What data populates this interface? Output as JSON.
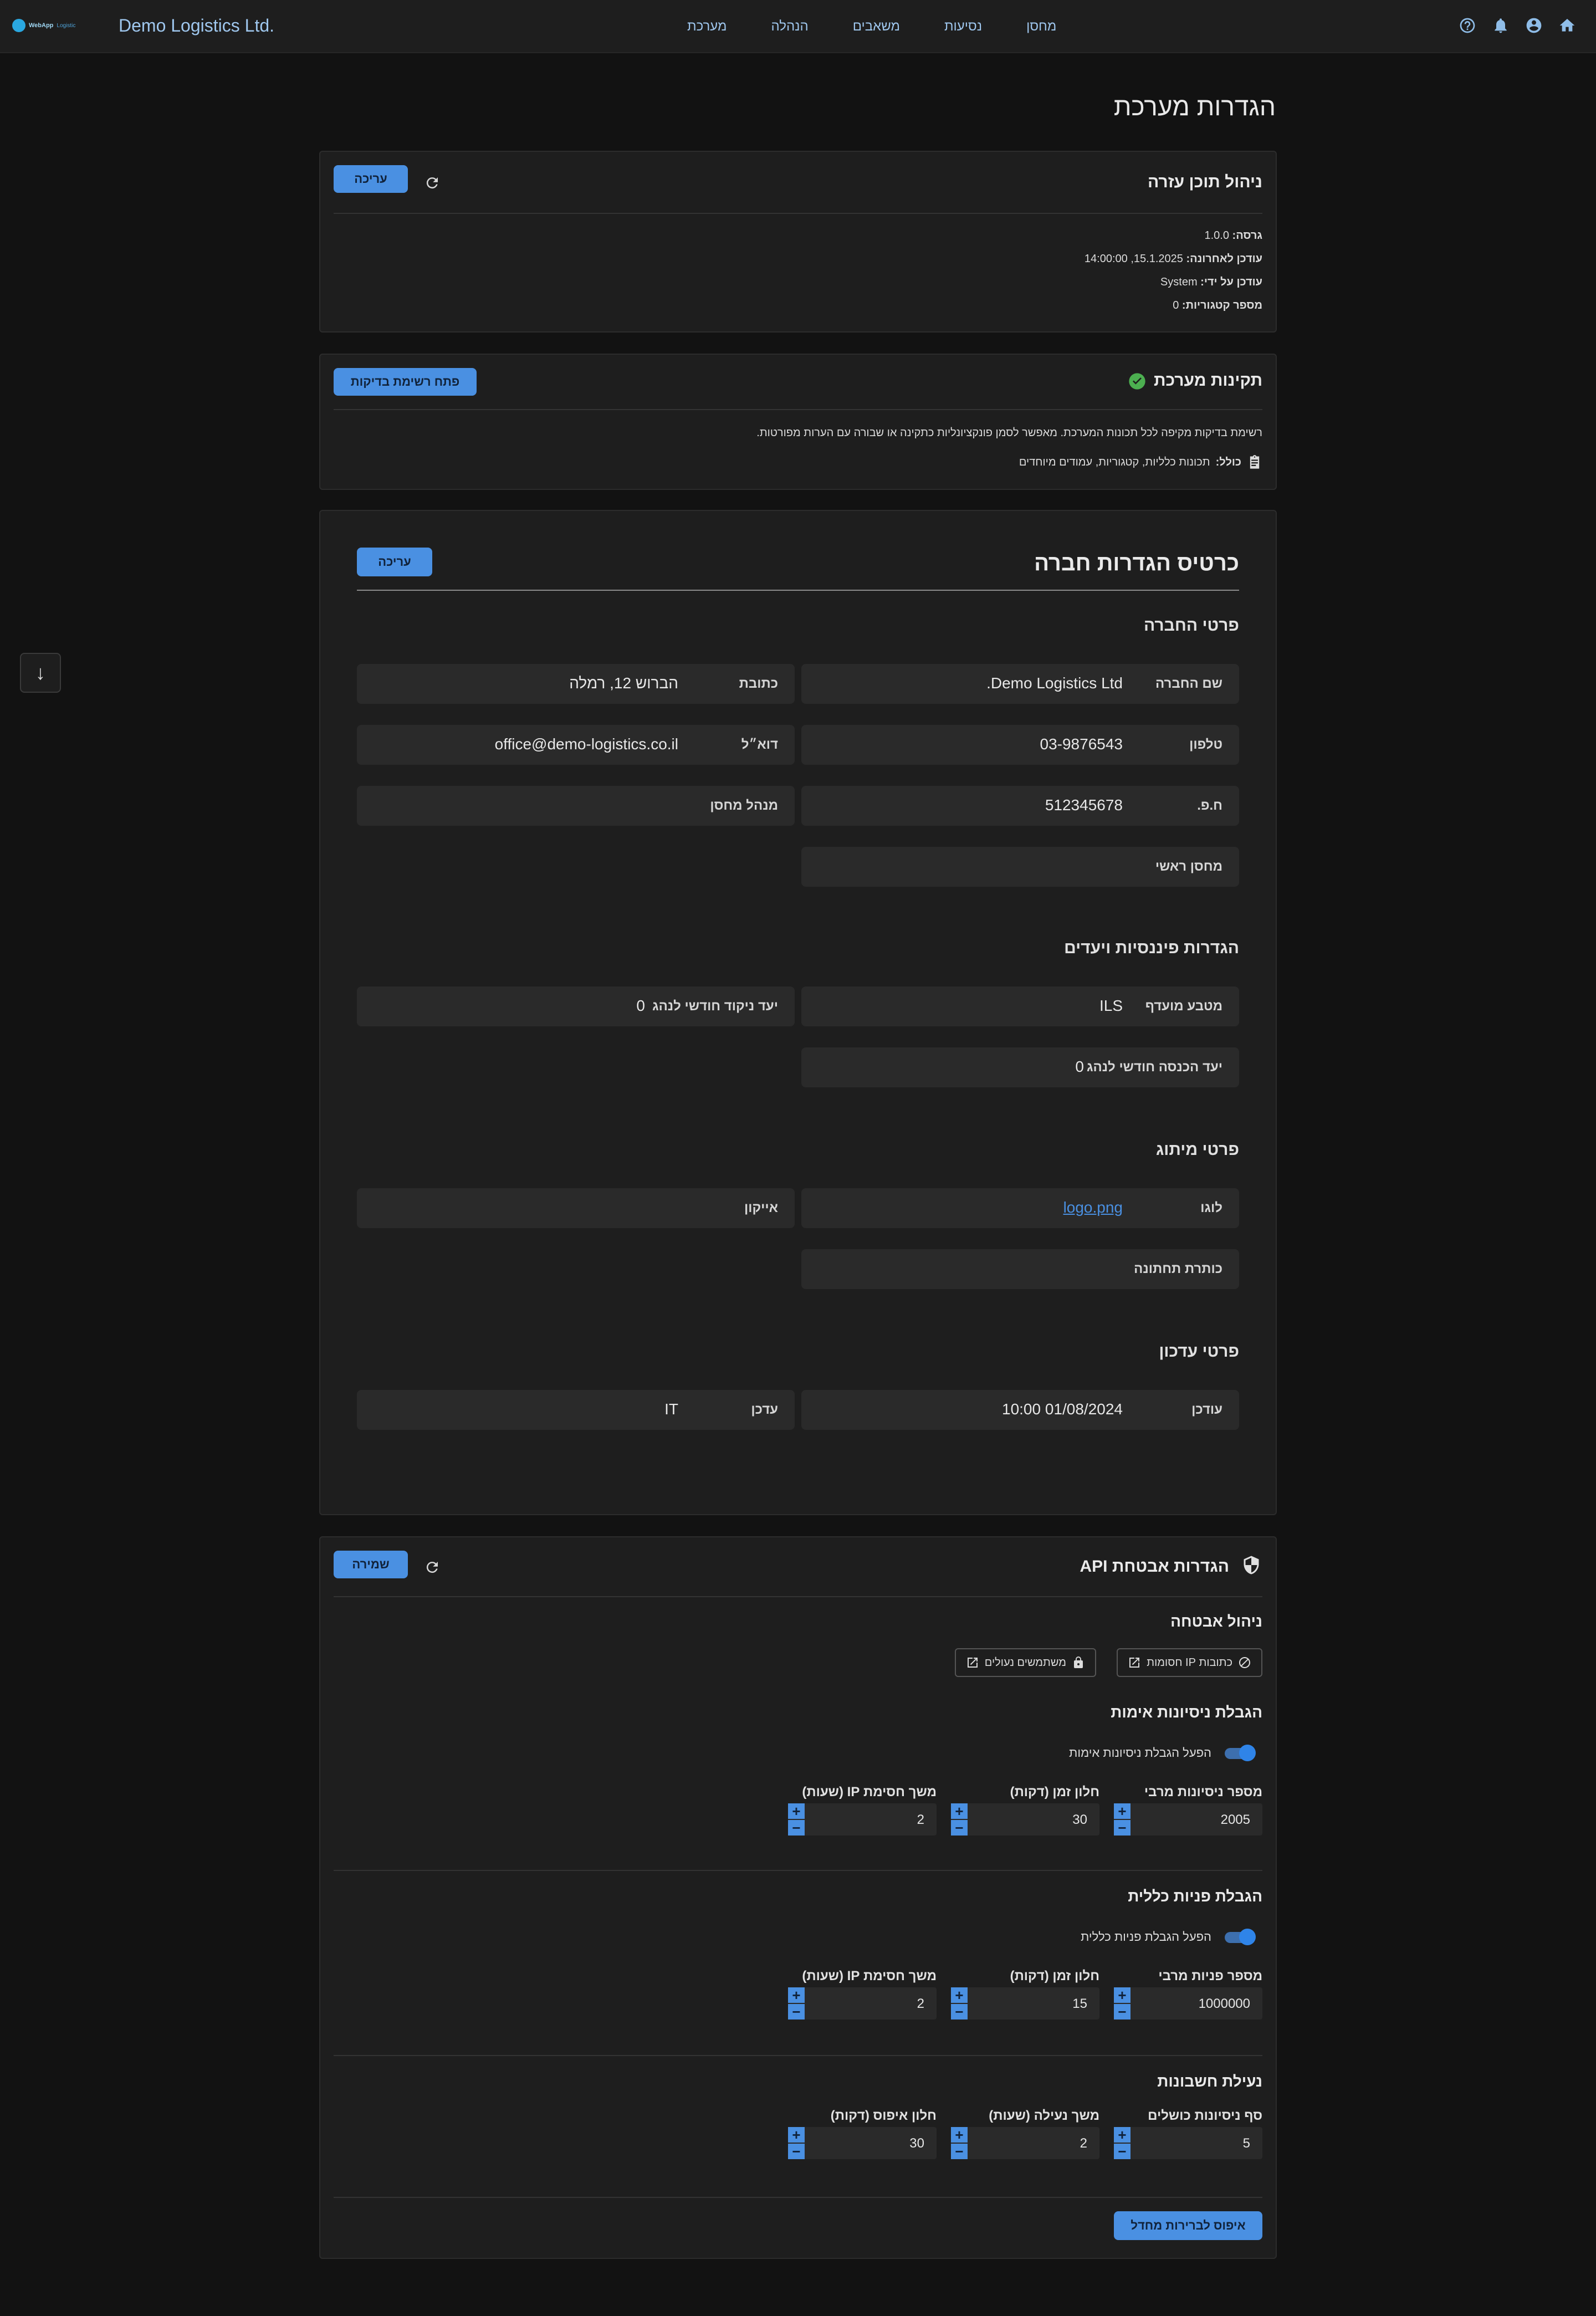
{
  "topbar": {
    "logo_text": "WebApp",
    "logo_sub": "Logistic",
    "company_name": "Demo Logistics Ltd.",
    "nav": [
      "מחסן",
      "נסיעות",
      "משאבים",
      "הנהלה",
      "מערכת"
    ],
    "icons": [
      "home-icon",
      "account-icon",
      "bell-icon",
      "help-icon"
    ]
  },
  "page": {
    "title": "הגדרות מערכת"
  },
  "help_card": {
    "title": "ניהול תוכן עזרה",
    "edit_label": "עריכה",
    "version_label": "גרסה:",
    "version": "1.0.0",
    "updated_label": "עודכן לאחרונה:",
    "updated": "15.1.2025, 14:00:00",
    "updated_by_label": "עודכן על ידי:",
    "updated_by": "System",
    "categories_label": "מספר קטגוריות:",
    "categories": "0"
  },
  "health_card": {
    "title": "תקינות מערכת",
    "button": "פתח רשימת בדיקות",
    "description": "רשימת בדיקות מקיפה לכל תכונות המערכת. מאפשר לסמן פונקציונליות כתקינה או שבורה עם הערות מפורטות.",
    "includes_label": "כולל:",
    "includes": "תכונות כלליות, קטגוריות, עמודים מיוחדים"
  },
  "company_card": {
    "title": "כרטיס הגדרות חברה",
    "edit_label": "עריכה",
    "sections": {
      "details": "פרטי החברה",
      "finance": "הגדרות פיננסיות ויעדים",
      "branding": "פרטי מיתוג",
      "update": "פרטי עדכון"
    },
    "fields": {
      "company_name": {
        "label": "שם החברה",
        "value": "Demo Logistics Ltd."
      },
      "address": {
        "label": "כתובת",
        "value": "הברוש 12, רמלה"
      },
      "phone": {
        "label": "טלפון",
        "value": "03-9876543"
      },
      "email": {
        "label": "דוא״ל",
        "value": "office@demo-logistics.co.il"
      },
      "hp": {
        "label": "ח.פ.",
        "value": "512345678"
      },
      "warehouse_manager": {
        "label": "מנהל מחסן",
        "value": ""
      },
      "main_warehouse": {
        "label": "מחסן ראשי",
        "value": ""
      },
      "currency": {
        "label": "מטבע מועדף",
        "value": "ILS"
      },
      "points_target": {
        "label": "יעד ניקוד חודשי לנהג",
        "value": "0"
      },
      "income_target": {
        "label": "יעד הכנסה חודשי לנהג",
        "value": "0"
      },
      "logo": {
        "label": "לוגו",
        "value": "logo.png"
      },
      "icon": {
        "label": "אייקון",
        "value": ""
      },
      "subtitle": {
        "label": "כותרת תחתונה",
        "value": ""
      },
      "updated": {
        "label": "עודכן",
        "value": "01/08/2024 10:00"
      },
      "updater": {
        "label": "עדכן",
        "value": "IT"
      }
    }
  },
  "api_card": {
    "title": "הגדרות אבטחת API",
    "save_label": "שמירה",
    "security_mgmt": "ניהול אבטחה",
    "blocked_ips": "כתובות IP חסומות",
    "locked_users": "משתמשים נעולים",
    "auth_limit": {
      "title": "הגבלת ניסיונות אימות",
      "toggle": "הפעל הגבלת ניסיונות אימות",
      "enabled": true,
      "fields": [
        {
          "label": "מספר ניסיונות מרבי",
          "value": "2005"
        },
        {
          "label": "חלון זמן (דקות)",
          "value": "30"
        },
        {
          "label": "משך חסימת IP (שעות)",
          "value": "2"
        }
      ]
    },
    "global_limit": {
      "title": "הגבלת פניות כללית",
      "toggle": "הפעל הגבלת פניות כללית",
      "enabled": true,
      "fields": [
        {
          "label": "מספר פניות מרבי",
          "value": "1000000"
        },
        {
          "label": "חלון זמן (דקות)",
          "value": "15"
        },
        {
          "label": "משך חסימת IP (שעות)",
          "value": "2"
        }
      ]
    },
    "lockout": {
      "title": "נעילת חשבונות",
      "fields": [
        {
          "label": "סף ניסיונות כושלים",
          "value": "5"
        },
        {
          "label": "משך נעילה (שעות)",
          "value": "2"
        },
        {
          "label": "חלון איפוס (דקות)",
          "value": "30"
        }
      ]
    },
    "reset_label": "איפוס לברירות מחדל"
  },
  "side": {
    "scroll_glyph": "↓"
  }
}
